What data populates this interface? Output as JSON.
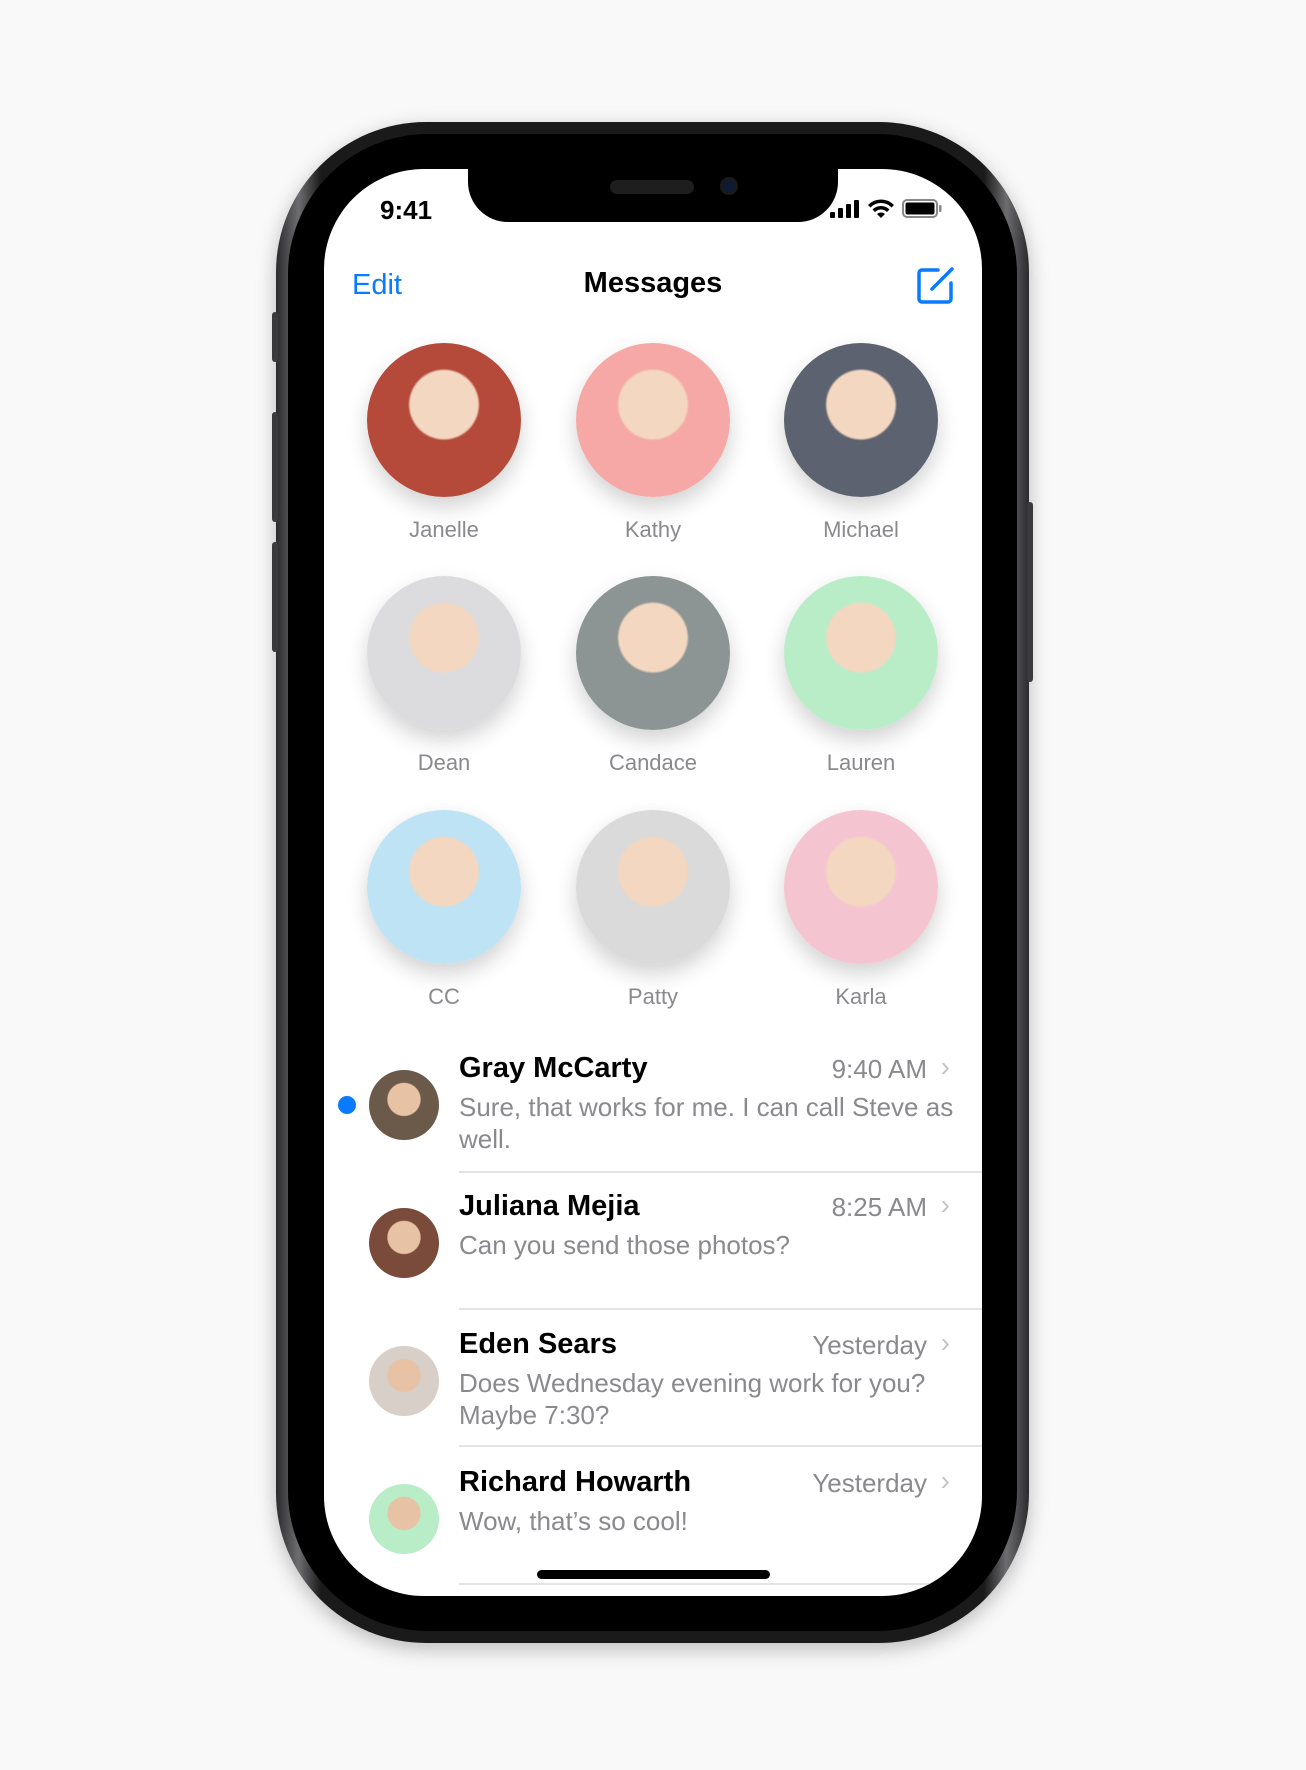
{
  "status_bar": {
    "time": "9:41",
    "icons": [
      "cellular-signal-icon",
      "wifi-icon",
      "battery-icon"
    ]
  },
  "nav": {
    "edit_label": "Edit",
    "title": "Messages",
    "compose_icon": "compose-icon"
  },
  "accent_color": "#0a7aff",
  "pinned": [
    {
      "name": "Janelle",
      "color": "#b5493a"
    },
    {
      "name": "Kathy",
      "color": "#f5a8a6"
    },
    {
      "name": "Michael",
      "color": "#5d6270"
    },
    {
      "name": "Dean",
      "color": "#dcdcdf"
    },
    {
      "name": "Candace",
      "color": "#8c9494"
    },
    {
      "name": "Lauren",
      "color": "#b9edc8"
    },
    {
      "name": "CC",
      "color": "#bde3f5"
    },
    {
      "name": "Patty",
      "color": "#dadada"
    },
    {
      "name": "Karla",
      "color": "#f4c5d1"
    }
  ],
  "conversations": [
    {
      "name": "Gray McCarty",
      "time": "9:40 AM",
      "message": "Sure, that works for me. I can call Steve as well.",
      "unread": true,
      "avatar_color": "#6b5a4a"
    },
    {
      "name": "Juliana Mejia",
      "time": "8:25 AM",
      "message": "Can you send those photos?",
      "unread": false,
      "avatar_color": "#7a4a3a"
    },
    {
      "name": "Eden Sears",
      "time": "Yesterday",
      "message": "Does Wednesday evening work for you? Maybe 7:30?",
      "unread": false,
      "avatar_color": "#d8cfc8"
    },
    {
      "name": "Richard Howarth",
      "time": "Yesterday",
      "message": "Wow, that’s so cool!",
      "unread": false,
      "avatar_color": "#b9edc8"
    }
  ]
}
